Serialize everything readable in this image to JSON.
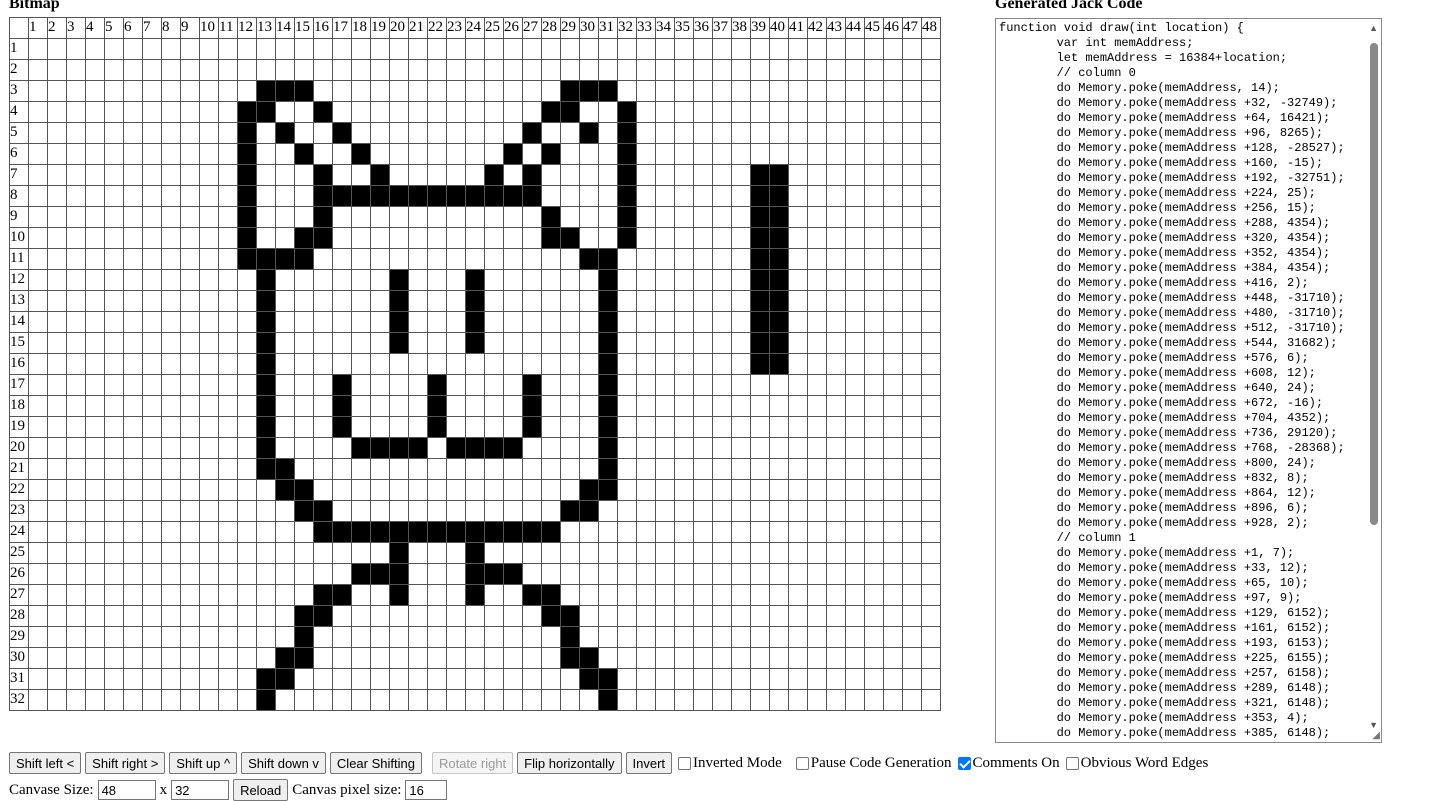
{
  "headings": {
    "bitmap": "Bitmap",
    "code": "Generated Jack Code"
  },
  "grid": {
    "columns": 48,
    "rows": 32,
    "filled_rows": {
      "3": [
        13,
        14,
        15,
        29,
        30,
        31
      ],
      "4": [
        12,
        13,
        16,
        28,
        29,
        32
      ],
      "5": [
        12,
        14,
        17,
        27,
        30,
        32
      ],
      "6": [
        12,
        15,
        18,
        26,
        28,
        32
      ],
      "7": [
        12,
        16,
        19,
        25,
        27,
        32,
        39,
        40
      ],
      "8": [
        12,
        16,
        17,
        18,
        19,
        20,
        21,
        22,
        23,
        24,
        25,
        26,
        27,
        32,
        39,
        40
      ],
      "9": [
        12,
        16,
        28,
        32,
        39,
        40
      ],
      "10": [
        12,
        15,
        16,
        28,
        29,
        32,
        39,
        40
      ],
      "11": [
        12,
        13,
        14,
        15,
        30,
        31,
        39,
        40
      ],
      "12": [
        13,
        20,
        24,
        31,
        39,
        40
      ],
      "13": [
        13,
        20,
        24,
        31,
        39,
        40
      ],
      "14": [
        13,
        20,
        24,
        31,
        39,
        40
      ],
      "15": [
        13,
        20,
        24,
        31,
        39,
        40
      ],
      "16": [
        13,
        31,
        39,
        40
      ],
      "17": [
        13,
        17,
        22,
        27,
        31
      ],
      "18": [
        13,
        17,
        22,
        27,
        31
      ],
      "19": [
        13,
        17,
        22,
        27,
        31
      ],
      "20": [
        13,
        18,
        19,
        20,
        21,
        23,
        24,
        25,
        26,
        31
      ],
      "21": [
        13,
        14,
        31
      ],
      "22": [
        14,
        15,
        30,
        31
      ],
      "23": [
        15,
        16,
        29,
        30
      ],
      "24": [
        16,
        17,
        18,
        19,
        20,
        21,
        22,
        23,
        24,
        25,
        26,
        27,
        28
      ],
      "25": [
        20,
        24
      ],
      "26": [
        18,
        19,
        20,
        24,
        25,
        26
      ],
      "27": [
        16,
        17,
        20,
        24,
        27,
        28
      ],
      "28": [
        15,
        16,
        28,
        29
      ],
      "29": [
        15,
        29
      ],
      "30": [
        14,
        15,
        29,
        30
      ],
      "31": [
        13,
        14,
        30,
        31
      ],
      "32": [
        13,
        31
      ]
    },
    "word_edges": [
      12,
      28
    ]
  },
  "code": {
    "lines": [
      "function void draw(int location) {",
      "        var int memAddress;",
      "        let memAddress = 16384+location;",
      "        // column 0",
      "        do Memory.poke(memAddress, 14);",
      "        do Memory.poke(memAddress +32, -32749);",
      "        do Memory.poke(memAddress +64, 16421);",
      "        do Memory.poke(memAddress +96, 8265);",
      "        do Memory.poke(memAddress +128, -28527);",
      "        do Memory.poke(memAddress +160, -15);",
      "        do Memory.poke(memAddress +192, -32751);",
      "        do Memory.poke(memAddress +224, 25);",
      "        do Memory.poke(memAddress +256, 15);",
      "        do Memory.poke(memAddress +288, 4354);",
      "        do Memory.poke(memAddress +320, 4354);",
      "        do Memory.poke(memAddress +352, 4354);",
      "        do Memory.poke(memAddress +384, 4354);",
      "        do Memory.poke(memAddress +416, 2);",
      "        do Memory.poke(memAddress +448, -31710);",
      "        do Memory.poke(memAddress +480, -31710);",
      "        do Memory.poke(memAddress +512, -31710);",
      "        do Memory.poke(memAddress +544, 31682);",
      "        do Memory.poke(memAddress +576, 6);",
      "        do Memory.poke(memAddress +608, 12);",
      "        do Memory.poke(memAddress +640, 24);",
      "        do Memory.poke(memAddress +672, -16);",
      "        do Memory.poke(memAddress +704, 4352);",
      "        do Memory.poke(memAddress +736, 29120);",
      "        do Memory.poke(memAddress +768, -28368);",
      "        do Memory.poke(memAddress +800, 24);",
      "        do Memory.poke(memAddress +832, 8);",
      "        do Memory.poke(memAddress +864, 12);",
      "        do Memory.poke(memAddress +896, 6);",
      "        do Memory.poke(memAddress +928, 2);",
      "        // column 1",
      "        do Memory.poke(memAddress +1, 7);",
      "        do Memory.poke(memAddress +33, 12);",
      "        do Memory.poke(memAddress +65, 10);",
      "        do Memory.poke(memAddress +97, 9);",
      "        do Memory.poke(memAddress +129, 6152);",
      "        do Memory.poke(memAddress +161, 6152);",
      "        do Memory.poke(memAddress +193, 6153);",
      "        do Memory.poke(memAddress +225, 6155);",
      "        do Memory.poke(memAddress +257, 6158);",
      "        do Memory.poke(memAddress +289, 6148);",
      "        do Memory.poke(memAddress +321, 6148);",
      "        do Memory.poke(memAddress +353, 4);",
      "        do Memory.poke(memAddress +385, 6148);"
    ]
  },
  "buttons": {
    "shift_left": "Shift left <",
    "shift_right": "Shift right >",
    "shift_up": "Shift up ^",
    "shift_down": "Shift down v",
    "clear_shifting": "Clear Shifting",
    "rotate_right": "Rotate right",
    "flip_horizontally": "Flip horizontally",
    "invert": "Invert",
    "reload": "Reload"
  },
  "checkboxes": {
    "inverted_mode": {
      "label": "Inverted Mode",
      "checked": false
    },
    "pause_code": {
      "label": "Pause Code Generation",
      "checked": false
    },
    "comments_on": {
      "label": "Comments On",
      "checked": true
    },
    "obvious_edges": {
      "label": "Obvious Word Edges",
      "checked": false
    }
  },
  "canvas": {
    "size_label": "Canvase Size:",
    "width": "48",
    "x_label": "x",
    "height": "32",
    "pixel_size_label": "Canvas pixel size:",
    "pixel_size": "16"
  },
  "colors": {
    "filled": "#000000",
    "word_edge": "#aa3333",
    "checkbox_accent": "#0075ff"
  }
}
